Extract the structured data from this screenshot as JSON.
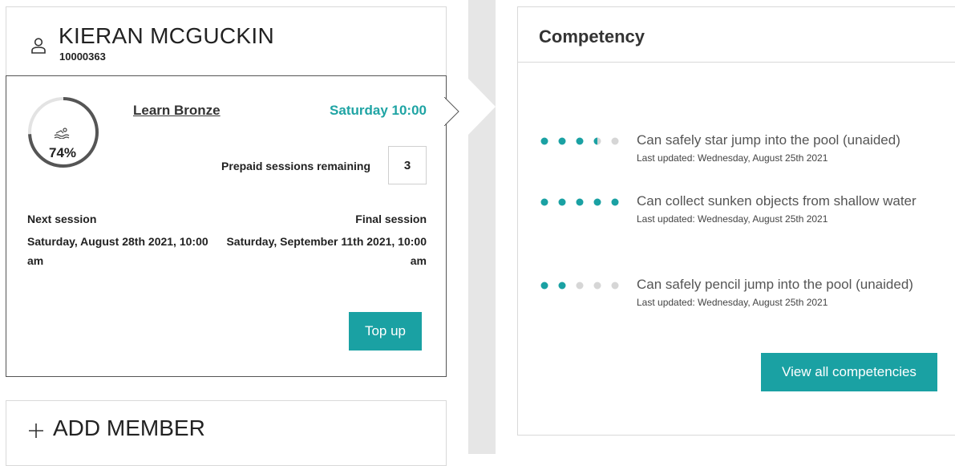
{
  "member": {
    "name": "KIERAN MCGUCKIN",
    "id": "10000363",
    "course": "Learn Bronze",
    "session_time": "Saturday 10:00",
    "progress": 0.74,
    "progress_label": "74%",
    "prepaid_label": "Prepaid sessions remaining",
    "prepaid_count": "3",
    "next_session_label": "Next session",
    "next_session_value": "Saturday, August 28th 2021, 10:00 am",
    "final_session_label": "Final session",
    "final_session_value": "Saturday, September 11th 2021, 10:00 am",
    "topup_label": "Top up"
  },
  "add_member": {
    "label": "ADD MEMBER"
  },
  "competency": {
    "title": "Competency",
    "items": [
      {
        "text": "Can safely star jump into the pool (unaided)",
        "updated": "Last updated: Wednesday, August 25th 2021",
        "level": 3.5,
        "max": 5
      },
      {
        "text": "Can collect sunken objects from shallow water",
        "updated": "Last updated: Wednesday, August 25th 2021",
        "level": 5,
        "max": 5
      },
      {
        "text": "Can safely pencil jump into the pool (unaided)",
        "updated": "Last updated: Wednesday, August 25th 2021",
        "level": 2,
        "max": 5
      }
    ],
    "view_all_label": "View all competencies"
  },
  "colors": {
    "accent": "#1aa1a3",
    "accent_text": "#1fa4a4",
    "dot_inactive": "#d6d6d6",
    "ring": "#555555",
    "ring_track": "#e3e3e3"
  },
  "icons": {
    "person": "person-icon",
    "swim": "swimmer-icon",
    "plus": "plus-icon",
    "chevron": "chevron-right-icon"
  }
}
